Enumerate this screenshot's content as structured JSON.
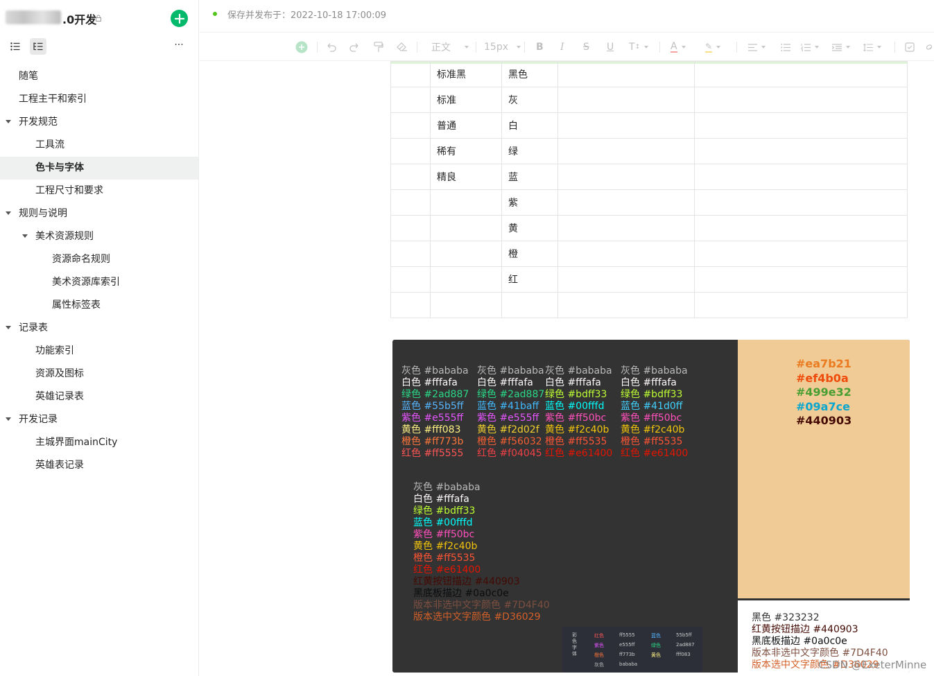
{
  "sidebar": {
    "title": ".0开发",
    "items": [
      {
        "label": "随笔",
        "level": 0,
        "caret": false
      },
      {
        "label": "工程主干和索引",
        "level": 0,
        "caret": false
      },
      {
        "label": "开发规范",
        "level": 0,
        "caret": true
      },
      {
        "label": "工具流",
        "level": 1,
        "caret": false
      },
      {
        "label": "色卡与字体",
        "level": 1,
        "caret": false,
        "active": true
      },
      {
        "label": "工程尺寸和要求",
        "level": 1,
        "caret": false
      },
      {
        "label": "规则与说明",
        "level": 0,
        "caret": true
      },
      {
        "label": "美术资源规则",
        "level": 1,
        "caret": true
      },
      {
        "label": "资源命名规则",
        "level": 2,
        "caret": false
      },
      {
        "label": "美术资源库索引",
        "level": 2,
        "caret": false
      },
      {
        "label": "属性标签表",
        "level": 2,
        "caret": false
      },
      {
        "label": "记录表",
        "level": 0,
        "caret": true
      },
      {
        "label": "功能索引",
        "level": 1,
        "caret": false
      },
      {
        "label": "资源及图标",
        "level": 1,
        "caret": false
      },
      {
        "label": "英雄记录表",
        "level": 1,
        "caret": false
      },
      {
        "label": "开发记录",
        "level": 0,
        "caret": true
      },
      {
        "label": "主城界面mainCity",
        "level": 1,
        "caret": false
      },
      {
        "label": "英雄表记录",
        "level": 1,
        "caret": false
      }
    ]
  },
  "topbar": {
    "status": "保存并发布于：2022-10-18 17:00:09"
  },
  "toolbar": {
    "style": "正文",
    "font_size": "15px"
  },
  "table": {
    "rows": [
      [
        "",
        "标准黑",
        "黑色",
        "",
        ""
      ],
      [
        "",
        "标准",
        "灰",
        "",
        ""
      ],
      [
        "",
        "普通",
        "白",
        "",
        ""
      ],
      [
        "",
        "稀有",
        "绿",
        "",
        ""
      ],
      [
        "",
        "精良",
        "蓝",
        "",
        ""
      ],
      [
        "",
        "",
        "紫",
        "",
        ""
      ],
      [
        "",
        "",
        "黄",
        "",
        ""
      ],
      [
        "",
        "",
        "橙",
        "",
        ""
      ],
      [
        "",
        "",
        "红",
        "",
        ""
      ],
      [
        "",
        "",
        "",
        "",
        ""
      ]
    ]
  },
  "palette": {
    "columns": [
      [
        {
          "t": "灰色 #bababa",
          "c": "#bababa"
        },
        {
          "t": "白色 #fffafa",
          "c": "#fffafa"
        },
        {
          "t": "绿色 #2ad887",
          "c": "#2ad887"
        },
        {
          "t": "蓝色 #55b5ff",
          "c": "#55b5ff"
        },
        {
          "t": "紫色 #e555ff",
          "c": "#e555ff"
        },
        {
          "t": "黄色 #fff083",
          "c": "#fff083"
        },
        {
          "t": "橙色 #ff773b",
          "c": "#ff773b"
        },
        {
          "t": "红色 #ff5555",
          "c": "#ff5555"
        }
      ],
      [
        {
          "t": "灰色 #bababa",
          "c": "#bababa"
        },
        {
          "t": "白色 #fffafa",
          "c": "#fffafa"
        },
        {
          "t": "绿色 #2ad887",
          "c": "#2ad887"
        },
        {
          "t": "蓝色 #41baff",
          "c": "#41baff"
        },
        {
          "t": "紫色 #e555ff",
          "c": "#e555ff"
        },
        {
          "t": "黄色 #f2d02f",
          "c": "#f2d02f"
        },
        {
          "t": "橙色 #f56032",
          "c": "#f56032"
        },
        {
          "t": "红色 #f04045",
          "c": "#f04045"
        }
      ],
      [
        {
          "t": "灰色 #bababa",
          "c": "#bababa"
        },
        {
          "t": "白色 #fffafa",
          "c": "#fffafa"
        },
        {
          "t": "绿色 #bdff33",
          "c": "#bdff33"
        },
        {
          "t": "蓝色 #00fffd",
          "c": "#00fffd"
        },
        {
          "t": "紫色 #ff50bc",
          "c": "#ff50bc"
        },
        {
          "t": "黄色 #f2c40b",
          "c": "#f2c40b"
        },
        {
          "t": "橙色 #ff5535",
          "c": "#ff5535"
        },
        {
          "t": "红色 #e61400",
          "c": "#e61400"
        }
      ],
      [
        {
          "t": "灰色 #bababa",
          "c": "#bababa"
        },
        {
          "t": "白色 #fffafa",
          "c": "#fffafa"
        },
        {
          "t": "绿色 #bdff33",
          "c": "#bdff33"
        },
        {
          "t": "蓝色 #41d0ff",
          "c": "#41d0ff"
        },
        {
          "t": "紫色 #ff50bc",
          "c": "#ff50bc"
        },
        {
          "t": "黄色 #f2c40b",
          "c": "#f2c40b"
        },
        {
          "t": "橙色 #ff5535",
          "c": "#ff5535"
        },
        {
          "t": "红色 #e61400",
          "c": "#e61400"
        }
      ]
    ],
    "lower": [
      {
        "t": "灰色 #bababa",
        "c": "#bababa"
      },
      {
        "t": "白色 #fffafa",
        "c": "#fffafa"
      },
      {
        "t": "绿色 #bdff33",
        "c": "#bdff33"
      },
      {
        "t": "蓝色 #00fffd",
        "c": "#00fffd"
      },
      {
        "t": "紫色 #ff50bc",
        "c": "#ff50bc"
      },
      {
        "t": "黄色 #f2c40b",
        "c": "#f2c40b"
      },
      {
        "t": "橙色 #ff5535",
        "c": "#ff5535"
      },
      {
        "t": "红色 #e61400",
        "c": "#e61400"
      },
      {
        "t": "红黄按钮描边 #440903",
        "c": "#440903"
      },
      {
        "t": "黑底板描边 #0a0c0e",
        "c": "#0a0c0e"
      },
      {
        "t": "版本非选中文字颜色 #7D4F40",
        "c": "#7D4F40"
      },
      {
        "t": "版本选中文字颜色 #D36029",
        "c": "#D36029"
      }
    ],
    "peach": [
      {
        "t": "#ea7b21",
        "c": "#ea7b21"
      },
      {
        "t": "#ef4b0a",
        "c": "#ef4b0a"
      },
      {
        "t": "#499e32",
        "c": "#499e32"
      },
      {
        "t": "#09a7ce",
        "c": "#09a7ce"
      },
      {
        "t": "#440903",
        "c": "#440903"
      }
    ],
    "white": [
      {
        "t": "黑色 #323232",
        "c": "#323232"
      },
      {
        "t": "红黄按钮描边 #440903",
        "c": "#440903"
      },
      {
        "t": "黑底板描边 #0a0c0e",
        "c": "#0a0c0e"
      },
      {
        "t": "版本非选中文字颜色 #7D4F40",
        "c": "#7D4F40"
      },
      {
        "t": "版本选中文字颜色 #D36029",
        "c": "#D36029"
      }
    ],
    "mini": {
      "side": "彩色字体",
      "names": [
        {
          "t": "红色",
          "c": "#ff5555"
        },
        {
          "t": "紫色",
          "c": "#e555ff"
        },
        {
          "t": "橙色",
          "c": "#ff773b"
        },
        {
          "t": "灰色",
          "c": "#bababa"
        },
        {
          "t": "蓝色",
          "c": "#55b5ff"
        },
        {
          "t": "绿色",
          "c": "#2ad887"
        },
        {
          "t": "黄色",
          "c": "#fff083"
        }
      ],
      "codes": [
        "ff5555",
        "e555ff",
        "ff773b",
        "bababa",
        "55b5ff",
        "2ad887",
        "fff083"
      ]
    }
  },
  "watermark": "CSDN @ExeterMinne"
}
